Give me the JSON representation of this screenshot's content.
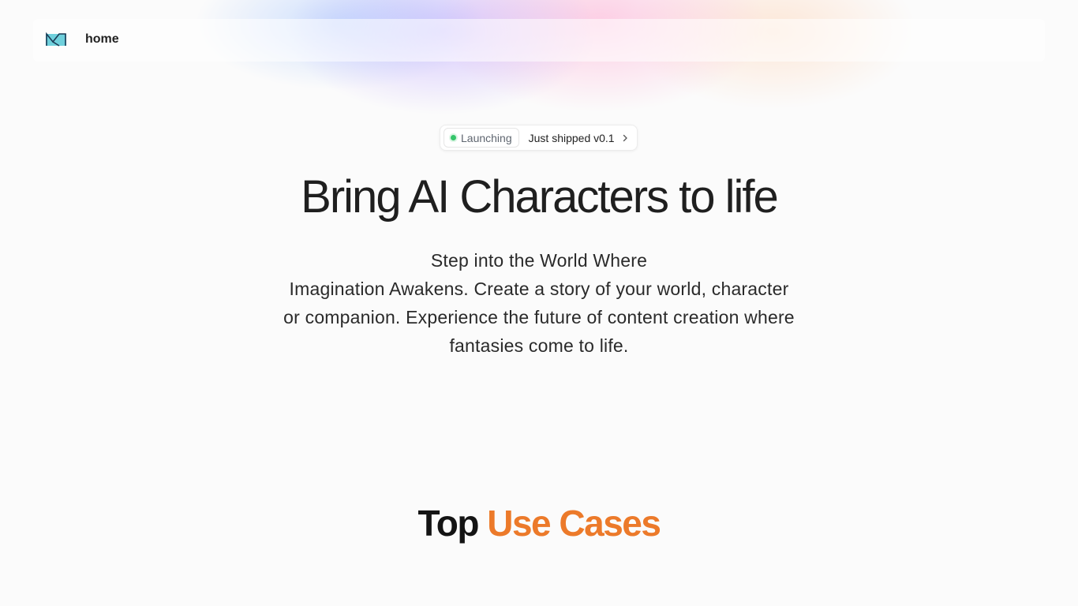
{
  "nav": {
    "logo": "logo-icon",
    "home_label": "home"
  },
  "badge": {
    "status_label": "Launching",
    "text": "Just shipped v0.1",
    "status_color": "#35c56a"
  },
  "hero": {
    "title": "Bring AI Characters to life",
    "subtitle_line1": "Step into the World Where",
    "subtitle_line2": "Imagination Awakens. Create a story of your world, character",
    "subtitle_line3": "or companion. Experience the future of content creation where",
    "subtitle_line4": "fantasies come to life."
  },
  "use_cases": {
    "title_part1": "Top",
    "title_part2": "Use Cases",
    "accent_color": "#ec7a2a"
  }
}
